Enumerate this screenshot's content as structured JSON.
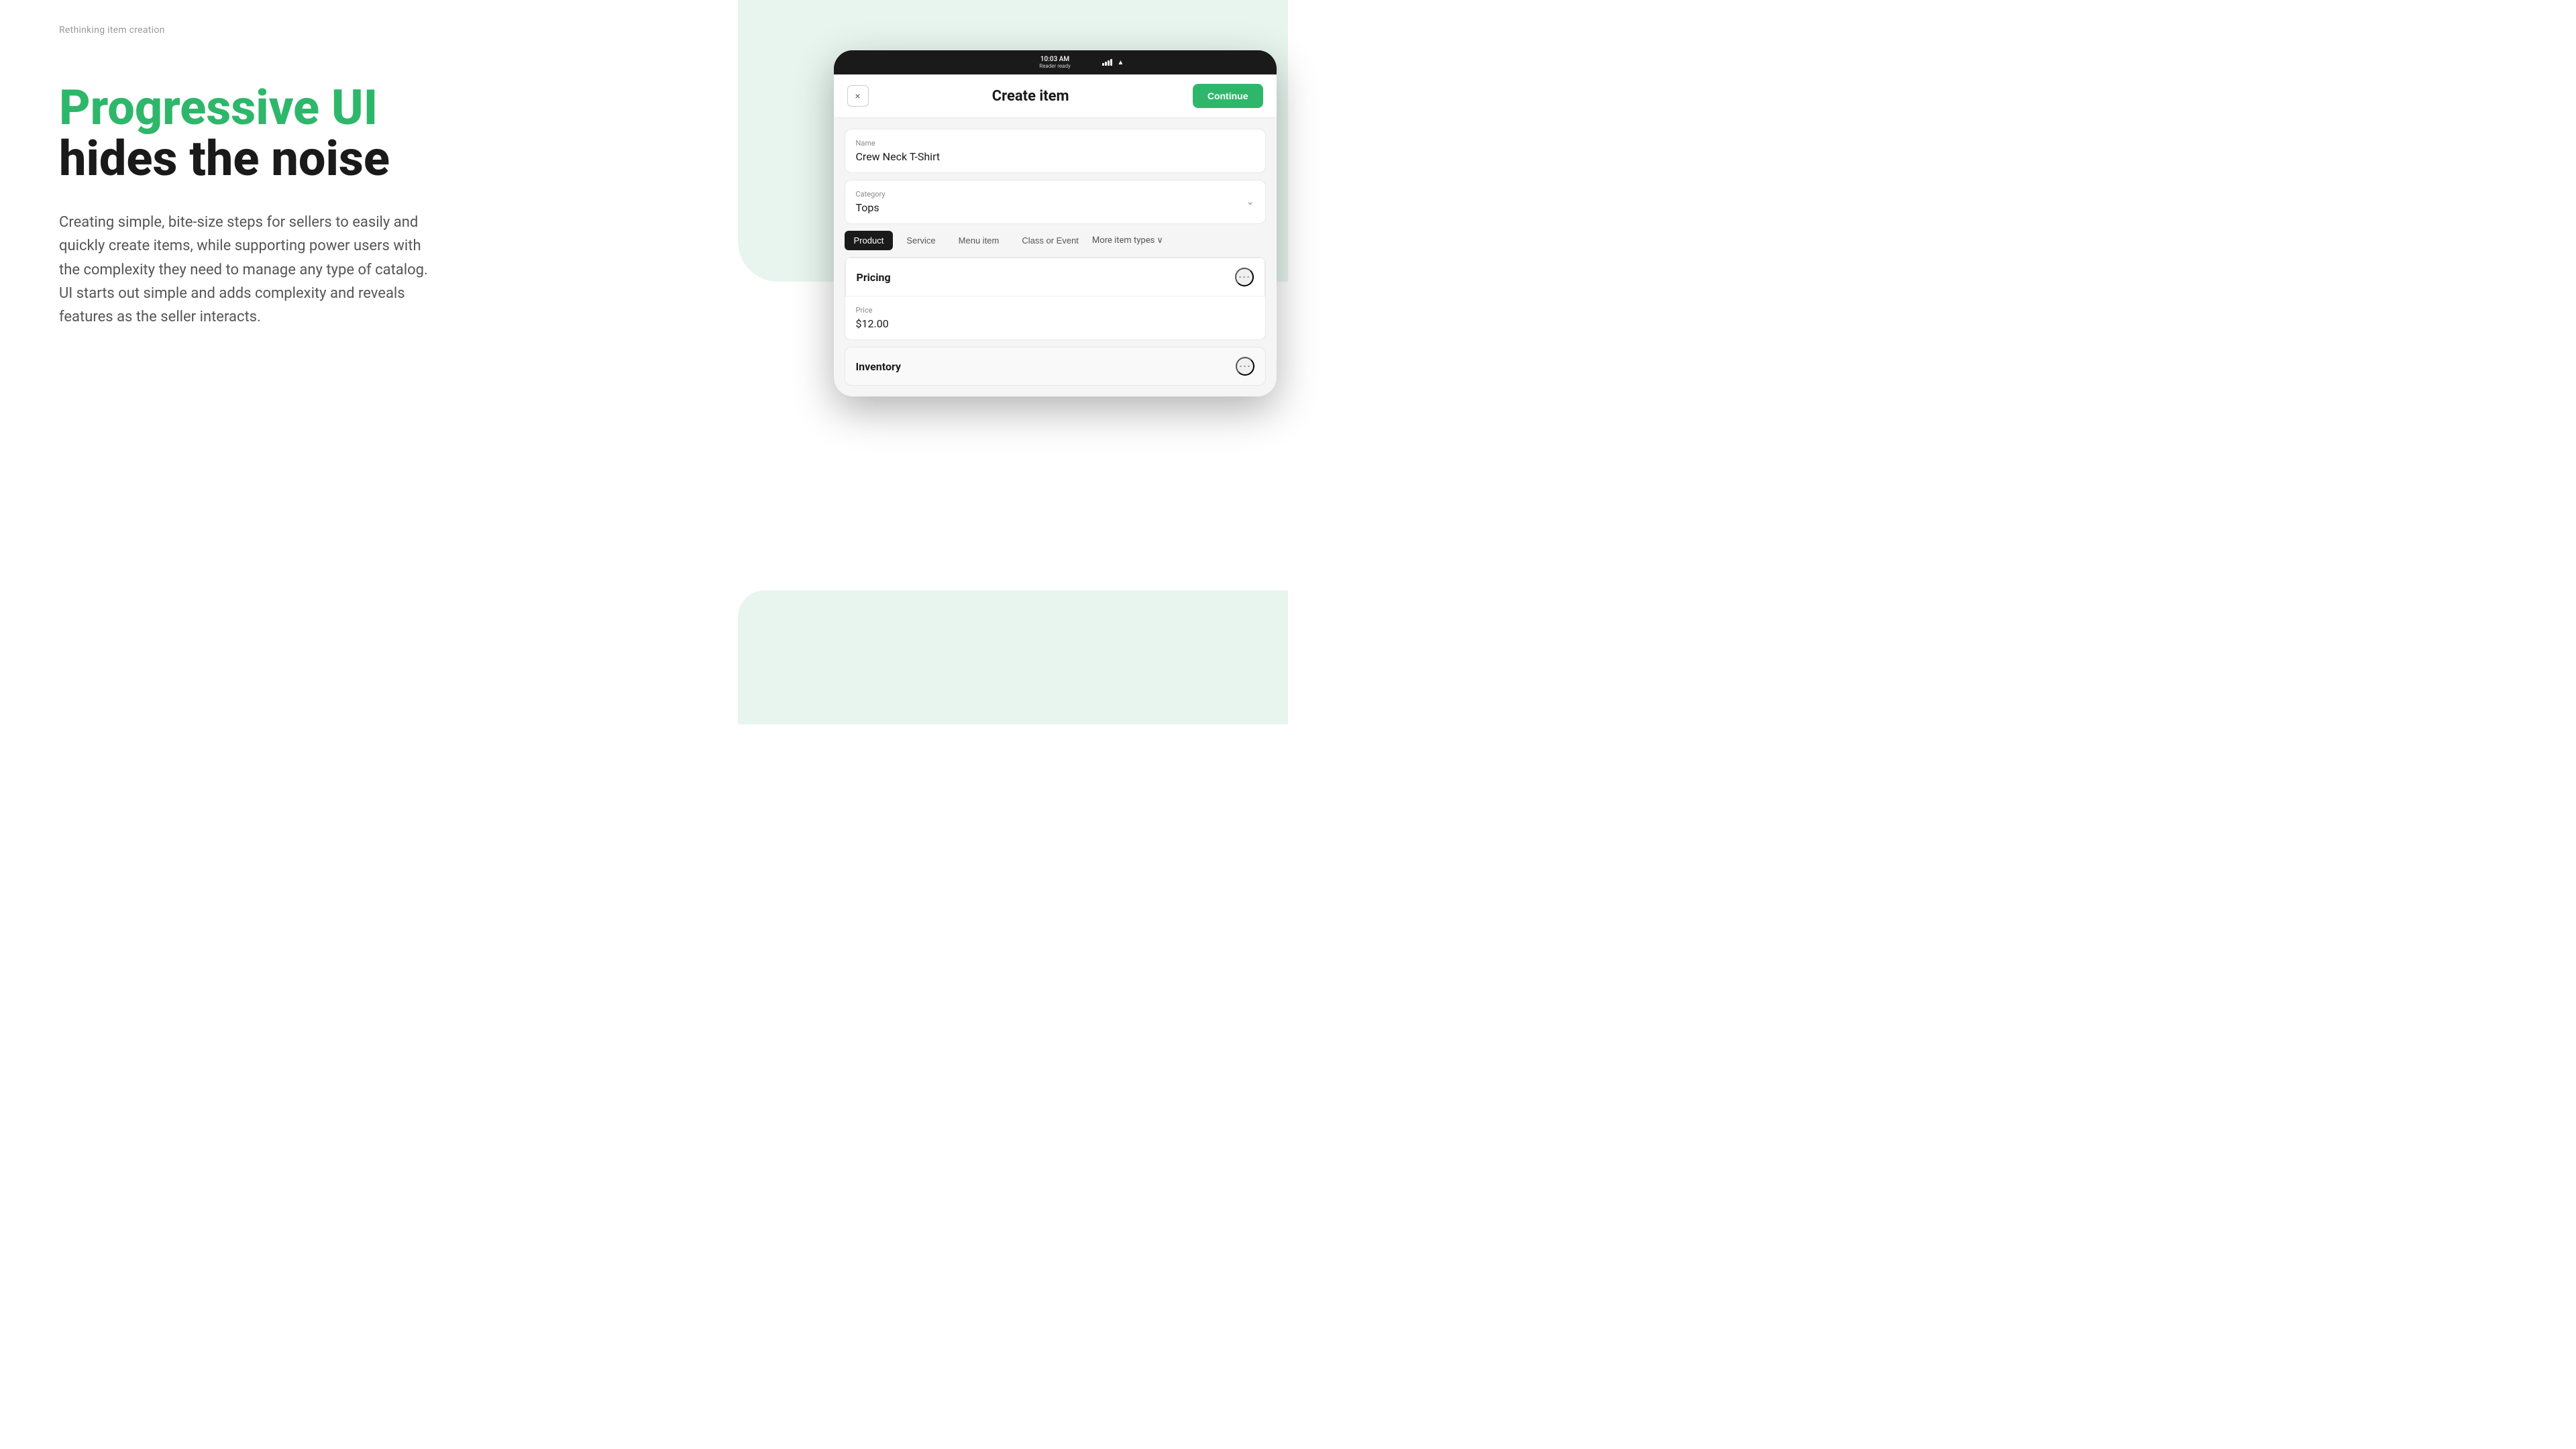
{
  "page": {
    "tagline": "Rethinking item creation",
    "headline_green": "Progressive UI",
    "headline_black": "hides the noise",
    "description": "Creating simple, bite-size steps for sellers to easily and quickly create items, while supporting power users with the complexity they need to manage any type of catalog. UI starts out simple and adds complexity and reveals features as the seller interacts."
  },
  "tablet": {
    "status_bar": {
      "time": "10:03 AM",
      "reader": "Reader ready"
    },
    "header": {
      "close_label": "×",
      "title": "Create item",
      "continue_label": "Continue"
    },
    "form": {
      "name_label": "Name",
      "name_value": "Crew Neck T-Shirt",
      "category_label": "Category",
      "category_value": "Tops"
    },
    "item_types": {
      "tabs": [
        {
          "label": "Product",
          "active": true
        },
        {
          "label": "Service",
          "active": false
        },
        {
          "label": "Menu item",
          "active": false
        },
        {
          "label": "Class or Event",
          "active": false
        }
      ],
      "more_label": "More item types",
      "more_chevron": "∨"
    },
    "sections": {
      "pricing": {
        "title": "Pricing",
        "price_label": "Price",
        "price_value": "$12.00",
        "ellipsis": "•••"
      },
      "inventory": {
        "title": "Inventory",
        "ellipsis": "•••"
      }
    }
  },
  "colors": {
    "green": "#2eb76a",
    "black": "#1a1a1a",
    "gray_text": "#555555",
    "light_gray": "#888888",
    "bg_mint": "#e8f5ef"
  }
}
